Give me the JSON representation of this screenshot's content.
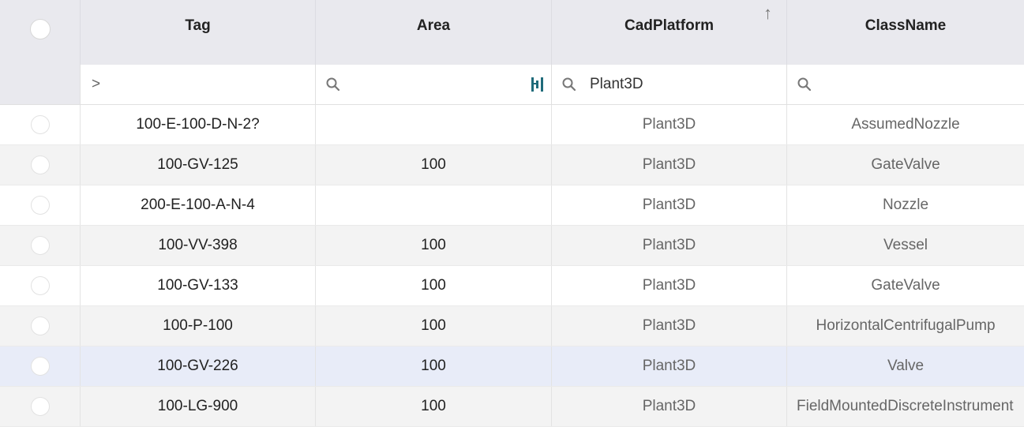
{
  "columns": {
    "tag": "Tag",
    "area": "Area",
    "cad_platform": "CadPlatform",
    "class_name": "ClassName"
  },
  "sort_indicator": "↑",
  "filters": {
    "tag_prompt": ">",
    "cad_platform_value": "Plant3D"
  },
  "rows": [
    {
      "tag": "100-E-100-D-N-2?",
      "area": "",
      "cad_platform": "Plant3D",
      "class_name": "AssumedNozzle"
    },
    {
      "tag": "100-GV-125",
      "area": "100",
      "cad_platform": "Plant3D",
      "class_name": "GateValve"
    },
    {
      "tag": "200-E-100-A-N-4",
      "area": "",
      "cad_platform": "Plant3D",
      "class_name": "Nozzle"
    },
    {
      "tag": "100-VV-398",
      "area": "100",
      "cad_platform": "Plant3D",
      "class_name": "Vessel"
    },
    {
      "tag": "100-GV-133",
      "area": "100",
      "cad_platform": "Plant3D",
      "class_name": "GateValve"
    },
    {
      "tag": "100-P-100",
      "area": "100",
      "cad_platform": "Plant3D",
      "class_name": "HorizontalCentrifugalPump"
    },
    {
      "tag": "100-GV-226",
      "area": "100",
      "cad_platform": "Plant3D",
      "class_name": "Valve"
    },
    {
      "tag": "100-LG-900",
      "area": "100",
      "cad_platform": "Plant3D",
      "class_name": "FieldMountedDiscreteInstrument"
    }
  ],
  "colors": {
    "header_bg": "#e9e9ee",
    "row_alt_bg": "#f3f3f3",
    "row_selected_bg": "#e8ecf8",
    "accent_icon": "#1f6b7a"
  }
}
